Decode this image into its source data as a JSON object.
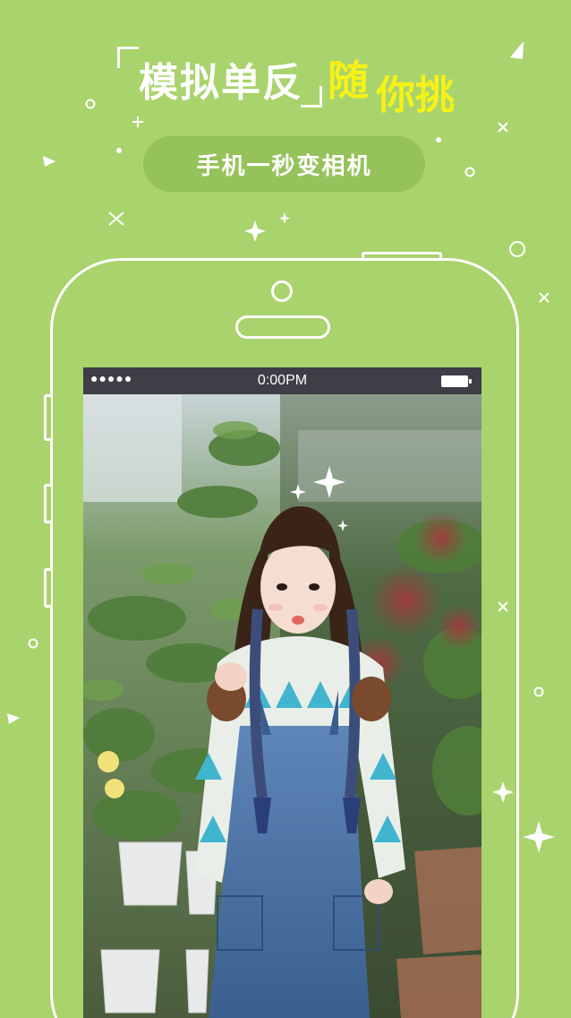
{
  "headline": {
    "main": "模拟单反",
    "accent_1": "随",
    "accent_2": "你挑"
  },
  "subtitle": "手机一秒变相机",
  "status_bar": {
    "signal": "●●●●●",
    "time": "0:00PM"
  },
  "photo": {
    "icon": "photo-of-girl-in-denim-overalls-among-flowers"
  },
  "colors": {
    "background": "#a9d36c",
    "accent": "#f5f219",
    "pill": "#95c25a",
    "status_bar": "#3e3e46"
  }
}
